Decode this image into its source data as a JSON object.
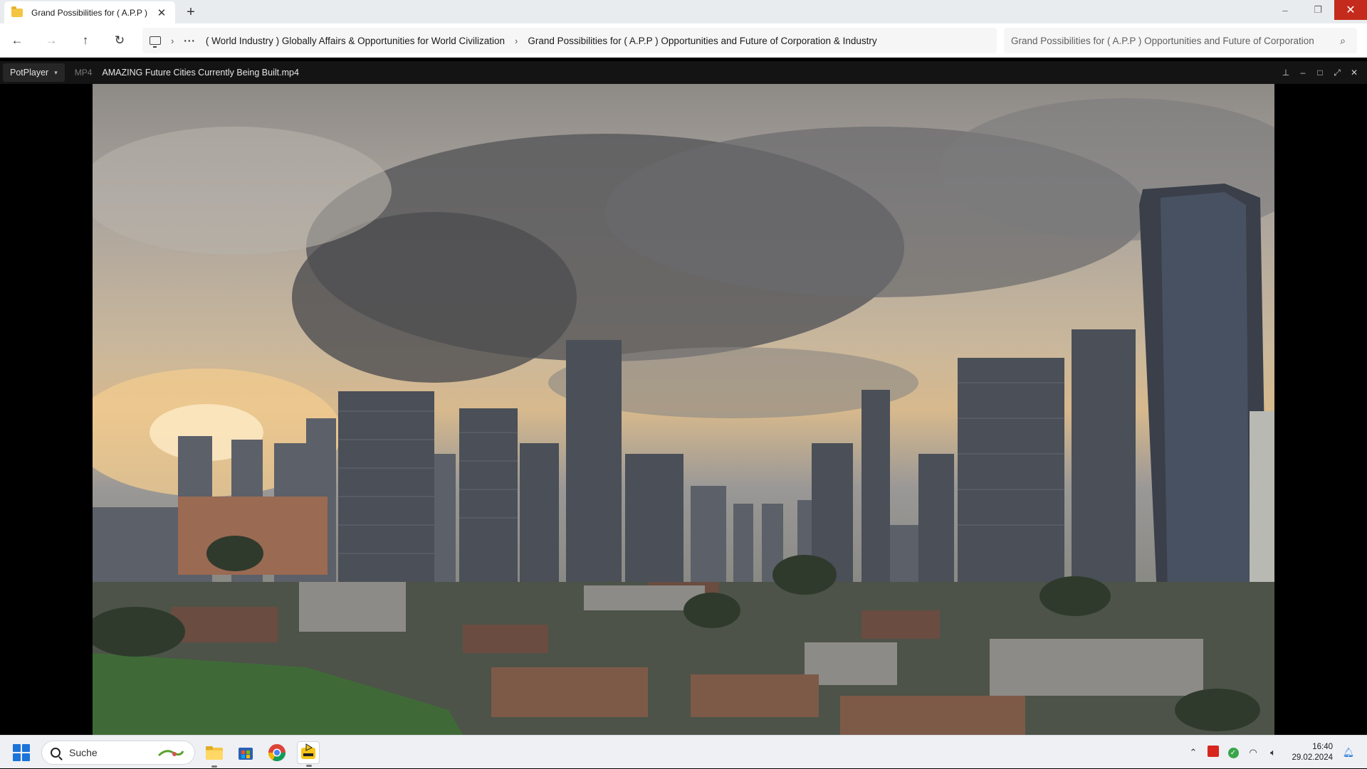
{
  "explorer": {
    "tab_title": "Grand Possibilities for ( A.P.P )",
    "new_tab": "+",
    "window_controls": {
      "minimize": "–",
      "restore": "❐",
      "close": "✕"
    },
    "breadcrumbs": [
      "( World Industry ) Globally Affairs & Opportunities for World Civilization",
      "Grand Possibilities for ( A.P.P ) Opportunities and Future of Corporation & Industry"
    ],
    "more": "···",
    "search_text": "Grand Possibilities for ( A.P.P ) Opportunities and Future of Corporation"
  },
  "player": {
    "menu_label": "PotPlayer",
    "format": "MP4",
    "video_title": "AMAZING Future Cities Currently Being Built.mp4",
    "sky_colors": {
      "cloud": "#5b5b5d",
      "sun": "#f3cc8f",
      "tower": "#3a3f4a"
    }
  },
  "taskbar": {
    "search_placeholder": "Suche",
    "time": "16:40",
    "date": "29.02.2024"
  }
}
